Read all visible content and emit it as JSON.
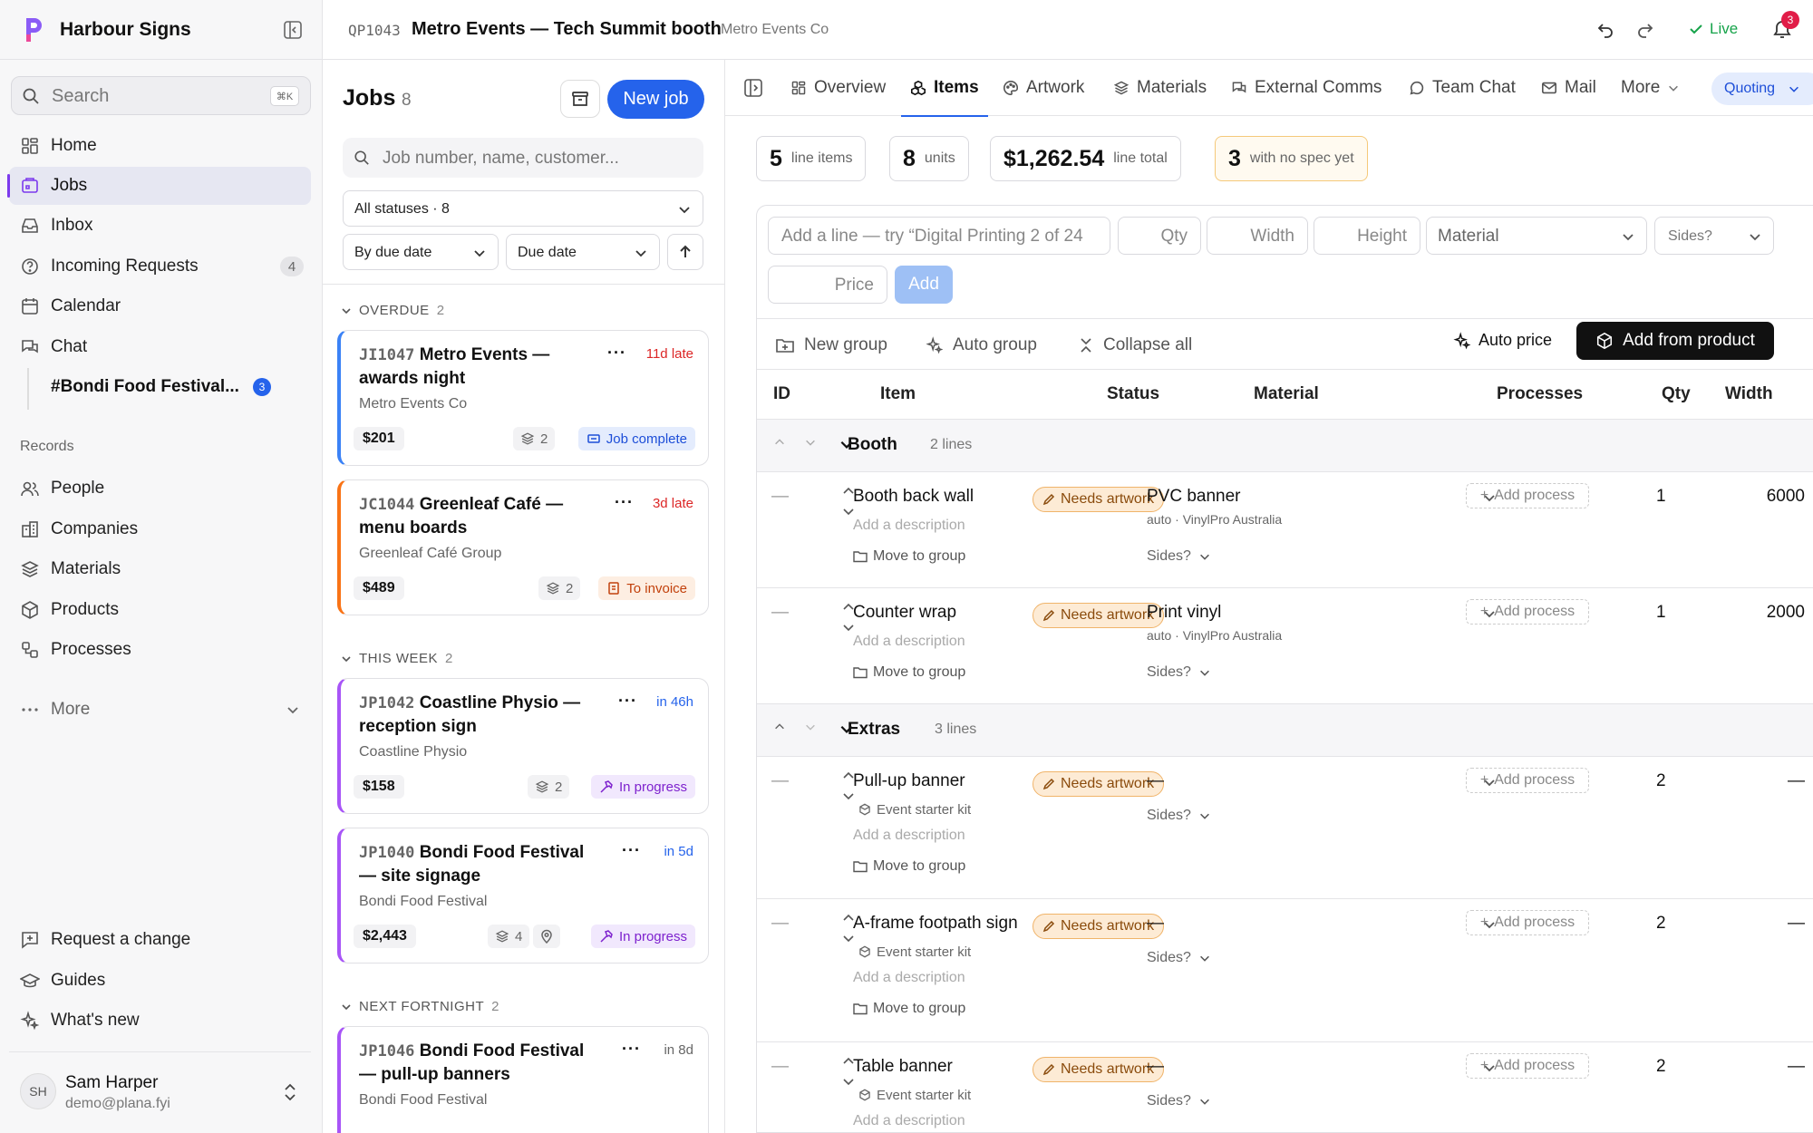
{
  "sidebar": {
    "brand": "Harbour Signs",
    "search": {
      "label": "Search",
      "shortcut": "⌘K"
    },
    "nav": [
      {
        "label": "Home",
        "icon": "home-icon"
      },
      {
        "label": "Jobs",
        "icon": "jobs-icon",
        "active": true
      },
      {
        "label": "Inbox",
        "icon": "inbox-icon"
      },
      {
        "label": "Incoming Requests",
        "icon": "help-circle-icon",
        "badge": "4"
      },
      {
        "label": "Calendar",
        "icon": "calendar-icon"
      },
      {
        "label": "Chat",
        "icon": "chat-icon"
      }
    ],
    "channel": {
      "label": "#Bondi Food Festival...",
      "badge": "3"
    },
    "records_label": "Records",
    "records": [
      {
        "label": "People",
        "icon": "people-icon"
      },
      {
        "label": "Companies",
        "icon": "building-icon"
      },
      {
        "label": "Materials",
        "icon": "layers-icon"
      },
      {
        "label": "Products",
        "icon": "box-icon"
      },
      {
        "label": "Processes",
        "icon": "processes-icon"
      }
    ],
    "more_label": "More",
    "footer": [
      {
        "label": "Request a change",
        "icon": "request-icon"
      },
      {
        "label": "Guides",
        "icon": "guides-icon"
      },
      {
        "label": "What's new",
        "icon": "sparkle-icon"
      }
    ],
    "user": {
      "initials": "SH",
      "name": "Sam Harper",
      "email": "demo@plana.fyi"
    }
  },
  "topbar": {
    "job_number": "QP1043",
    "title": "Metro Events — Tech Summit booth",
    "customer": "Metro Events Co",
    "live_label": "Live",
    "notifications": "3"
  },
  "jobs": {
    "title": "Jobs",
    "count": "8",
    "new_job": "New job",
    "search_placeholder": "Job number, name, customer...",
    "status_filter": "All statuses · 8",
    "sort_by": "By due date",
    "date_field": "Due date",
    "groups": [
      {
        "label": "OVERDUE",
        "count": "2"
      },
      {
        "label": "THIS WEEK",
        "count": "2"
      },
      {
        "label": "NEXT FORTNIGHT",
        "count": "2"
      }
    ],
    "cards": [
      {
        "number": "JI1047",
        "title": "Metro Events — awards night",
        "due": "11d late",
        "customer": "Metro Events Co",
        "amount": "$201",
        "items": "2",
        "status": "Job complete"
      },
      {
        "number": "JC1044",
        "title": "Greenleaf Café — menu boards",
        "due": "3d late",
        "customer": "Greenleaf Café Group",
        "amount": "$489",
        "items": "2",
        "status": "To invoice"
      },
      {
        "number": "JP1042",
        "title": "Coastline Physio — reception sign",
        "due": "in 46h",
        "customer": "Coastline Physio",
        "amount": "$158",
        "items": "2",
        "status": "In progress"
      },
      {
        "number": "JP1040",
        "title": "Bondi Food Festival — site signage",
        "due": "in 5d",
        "customer": "Bondi Food Festival",
        "amount": "$2,443",
        "items": "4",
        "status": "In progress"
      },
      {
        "number": "JP1046",
        "title": "Bondi Food Festival — pull-up banners",
        "due": "in 8d",
        "customer": "Bondi Food Festival",
        "amount": "",
        "items": "",
        "status": ""
      }
    ]
  },
  "tabs": [
    {
      "label": "Overview",
      "icon": "grid-icon"
    },
    {
      "label": "Items",
      "icon": "boxes-icon",
      "active": true
    },
    {
      "label": "Artwork",
      "icon": "palette-icon"
    },
    {
      "label": "Materials",
      "icon": "layers-icon"
    },
    {
      "label": "External Comms",
      "icon": "comms-icon"
    },
    {
      "label": "Team Chat",
      "icon": "chat-bubble-icon"
    },
    {
      "label": "Mail",
      "icon": "mail-icon"
    },
    {
      "label": "More",
      "icon": "chevron-down-icon"
    }
  ],
  "stage": "Quoting",
  "stats": [
    {
      "value": "5",
      "label": "line items"
    },
    {
      "value": "8",
      "label": "units"
    },
    {
      "value": "$1,262.54",
      "label": "line total"
    },
    {
      "value": "3",
      "label": "with no spec yet"
    }
  ],
  "add_line": {
    "placeholder": "Add a line — try “Digital Printing 2 of 24",
    "qty": "Qty",
    "width": "Width",
    "height": "Height",
    "material": "Material",
    "sides": "Sides?",
    "price": "Price",
    "add": "Add"
  },
  "toolbar": {
    "new_group": "New group",
    "auto_group": "Auto group",
    "collapse_all": "Collapse all",
    "auto_price": "Auto price",
    "add_from_product": "Add from product"
  },
  "columns": [
    "ID",
    "Item",
    "Status",
    "Material",
    "Processes",
    "Qty",
    "Width"
  ],
  "groups": [
    {
      "name": "Booth",
      "count": "2 lines",
      "items": [
        {
          "id": "—",
          "name": "Booth back wall",
          "status": "Needs artwork",
          "material": "PVC banner",
          "material_sub": "auto · VinylPro Australia",
          "sides": "Sides?",
          "add_process": "Add process",
          "qty": "1",
          "width": "6000",
          "description": "Add a description",
          "move": "Move to group"
        },
        {
          "id": "—",
          "name": "Counter wrap",
          "status": "Needs artwork",
          "material": "Print vinyl",
          "material_sub": "auto · VinylPro Australia",
          "sides": "Sides?",
          "add_process": "Add process",
          "qty": "1",
          "width": "2000",
          "description": "Add a description",
          "move": "Move to group"
        }
      ]
    },
    {
      "name": "Extras",
      "count": "3 lines",
      "items": [
        {
          "id": "—",
          "name": "Pull-up banner",
          "kit": "Event starter kit",
          "status": "Needs artwork",
          "material": "—",
          "sides": "Sides?",
          "add_process": "Add process",
          "qty": "2",
          "width": "—",
          "description": "Add a description",
          "move": "Move to group"
        },
        {
          "id": "—",
          "name": "A-frame footpath sign",
          "kit": "Event starter kit",
          "status": "Needs artwork",
          "material": "—",
          "sides": "Sides?",
          "add_process": "Add process",
          "qty": "2",
          "width": "—",
          "description": "Add a description",
          "move": "Move to group"
        },
        {
          "id": "—",
          "name": "Table banner",
          "kit": "Event starter kit",
          "status": "Needs artwork",
          "material": "—",
          "sides": "Sides?",
          "add_process": "Add process",
          "qty": "2",
          "width": "—",
          "description": "Add a description"
        }
      ]
    }
  ],
  "colors": {
    "accent": "#2563eb",
    "brand": "#7c3aed",
    "overdue": "#dc2626",
    "warning": "#f0b46a",
    "live": "#16a34a"
  }
}
